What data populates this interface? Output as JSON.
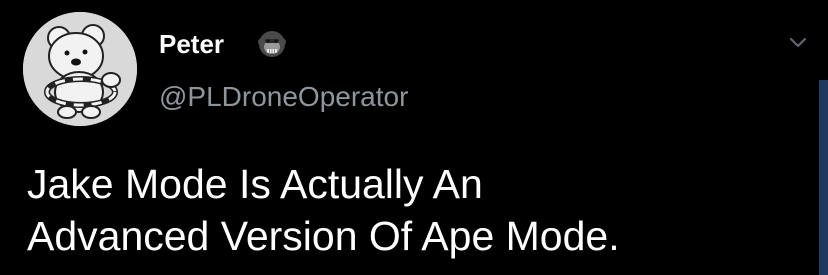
{
  "tweet": {
    "author": {
      "display_name": "Peter",
      "handle": "@PLDroneOperator",
      "name_emoji": "gorilla-emoji",
      "avatar": "teddy-bear-avatar"
    },
    "text_lines": [
      "Jake Mode Is Actually An",
      "Advanced Version Of Ape Mode."
    ],
    "menu_icon": "chevron-down-icon"
  },
  "colors": {
    "background": "#000000",
    "primary_text": "#ffffff",
    "secondary_text": "#8e959c",
    "scrollbar": "#1f3a5c"
  }
}
